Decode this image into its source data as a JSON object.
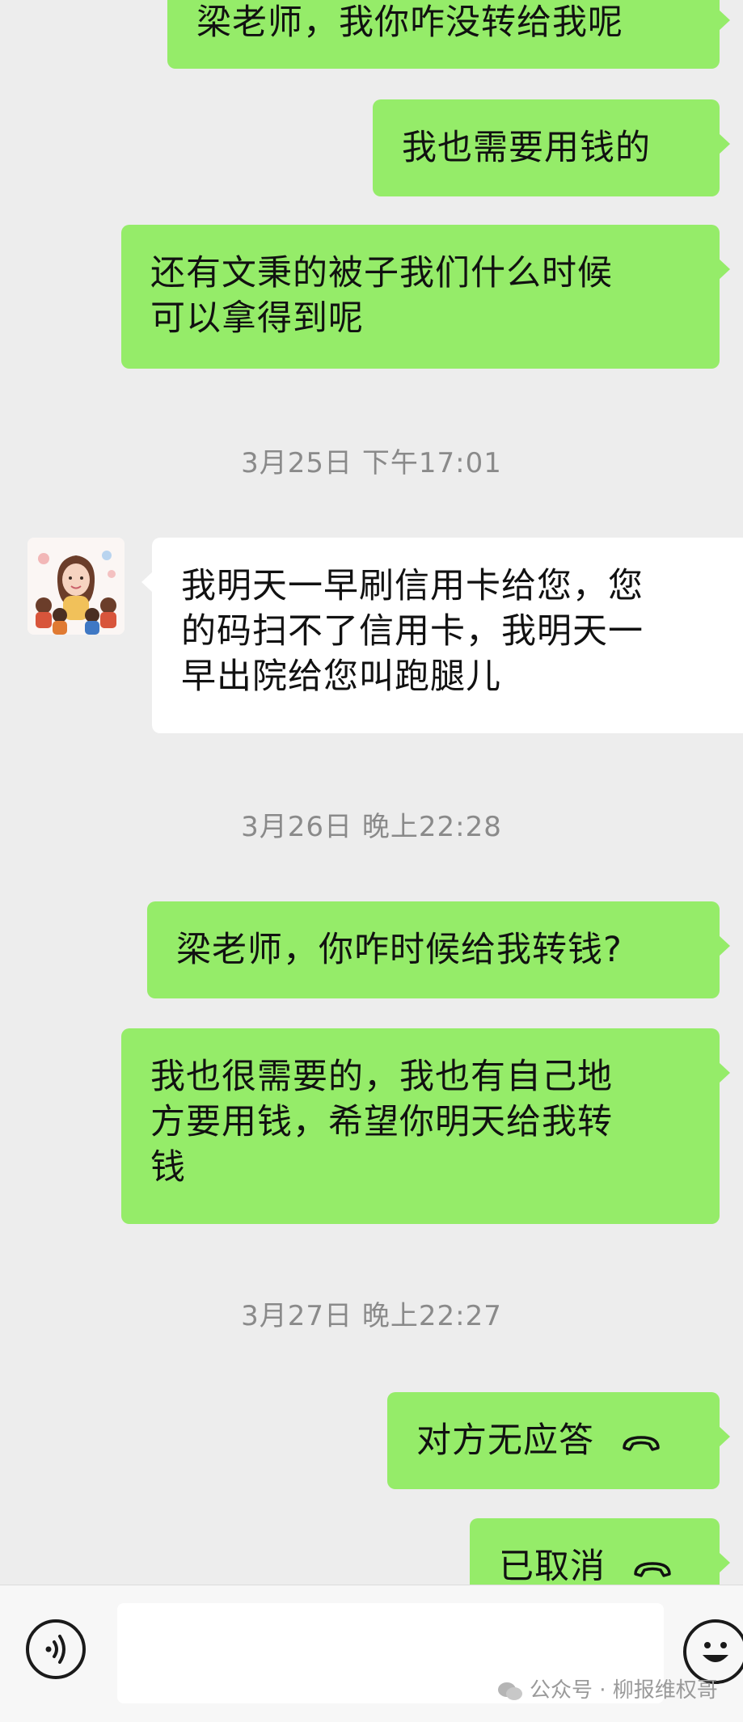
{
  "messages": [
    {
      "direction": "out",
      "text": "梁老师，我你咋没转给我呢"
    },
    {
      "direction": "out",
      "text": "我也需要用钱的"
    },
    {
      "direction": "out",
      "lines": [
        "还有文秉的被子我们什么时候",
        "可以拿得到呢"
      ]
    },
    {
      "type": "time",
      "text": "3月25日 下午17:01"
    },
    {
      "direction": "in",
      "lines": [
        "我明天一早刷信用卡给您，您",
        "的码扫不了信用卡，我明天一",
        "早出院给您叫跑腿儿"
      ]
    },
    {
      "type": "time",
      "text": "3月26日 晚上22:28"
    },
    {
      "direction": "out",
      "text": "梁老师，你咋时候给我转钱?"
    },
    {
      "direction": "out",
      "lines": [
        "我也很需要的，我也有自己地",
        "方要用钱，希望你明天给我转",
        "钱"
      ]
    },
    {
      "type": "time",
      "text": "3月27日 晚上22:27"
    },
    {
      "direction": "out",
      "type": "call",
      "text": "对方无应答"
    },
    {
      "direction": "out",
      "type": "call",
      "text": "已取消"
    }
  ],
  "input_bar": {
    "placeholder": ""
  },
  "watermark": "公众号 · 柳报维权哥",
  "icons": {
    "call": "phone-hangup-icon",
    "voice": "voice-icon",
    "emoji": "emoji-icon",
    "avatar": "avatar"
  },
  "colors": {
    "outgoing": "#95ec69",
    "incoming": "#ffffff",
    "background": "#ededed"
  }
}
